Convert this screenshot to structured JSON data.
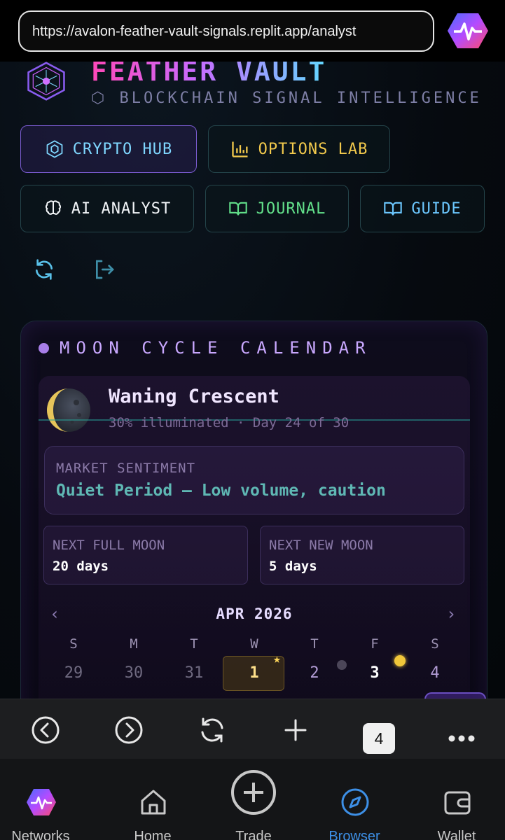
{
  "browser": {
    "url": "https://avalon-feather-vault-signals.replit.app/analyst",
    "tab_count": "4"
  },
  "app": {
    "title": "FEATHER VAULT",
    "subtitle": "⬡ BLOCKCHAIN SIGNAL INTELLIGENCE",
    "nav": {
      "crypto_hub": "CRYPTO HUB",
      "options_lab": "OPTIONS LAB",
      "ai_analyst": "AI ANALYST",
      "journal": "JOURNAL",
      "guide": "GUIDE"
    }
  },
  "moon_calendar": {
    "title": "MOON CYCLE CALENDAR",
    "phase_name": "Waning Crescent",
    "phase_detail": "30% illuminated · Day 24 of 30",
    "sentiment_label": "MARKET SENTIMENT",
    "sentiment_value": "Quiet Period — Low volume, caution",
    "next_full_label": "NEXT FULL MOON",
    "next_full_value": "20 days",
    "next_new_label": "NEXT NEW MOON",
    "next_new_value": "5 days",
    "month": "APR 2026",
    "weekdays": [
      "S",
      "M",
      "T",
      "W",
      "T",
      "F",
      "S"
    ],
    "days": [
      "29",
      "30",
      "31",
      "1",
      "2",
      "3",
      "4"
    ]
  },
  "bottom_nav": {
    "networks": "Networks",
    "home": "Home",
    "trade": "Trade",
    "browser": "Browser",
    "wallet": "Wallet"
  },
  "colors": {
    "accent_purple": "#a87ee8",
    "accent_cyan": "#6cc8ff",
    "accent_gold": "#f2c94c",
    "browser_active": "#3d8fe6"
  }
}
